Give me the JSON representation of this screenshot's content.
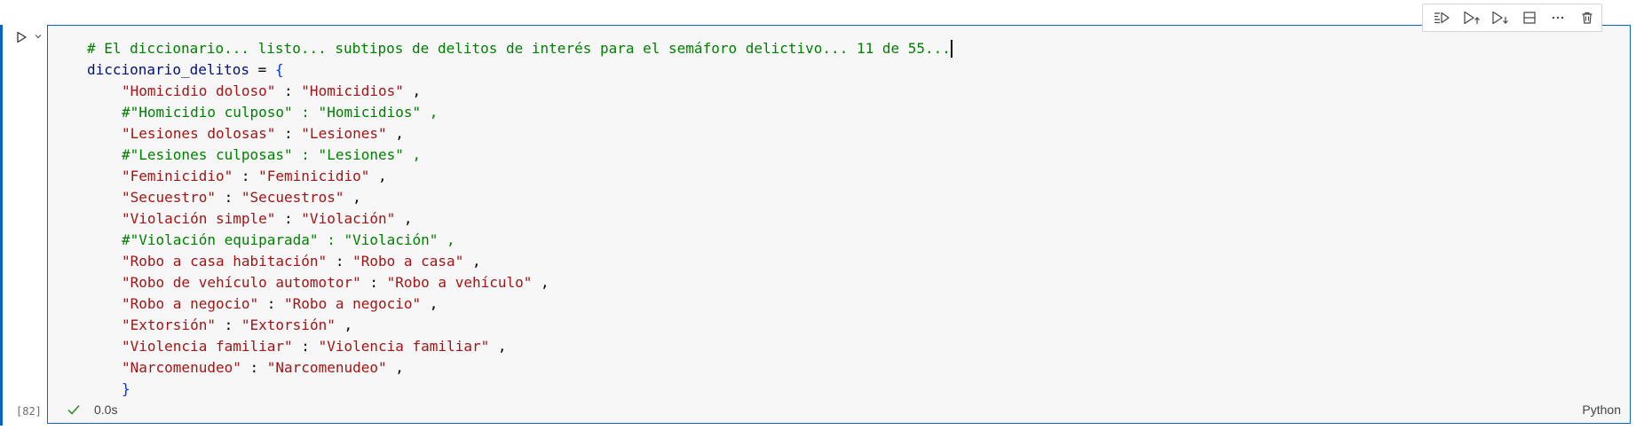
{
  "cell": {
    "execution_count": "[82]",
    "status": {
      "duration": "0.0s",
      "language": "Python",
      "success_color": "#388a34"
    },
    "code_lines": [
      {
        "kind": "comment",
        "text": "# El diccionario... listo... subtipos de delitos de interés para el semáforo delictivo... 11 de 55..."
      },
      {
        "kind": "assign",
        "var": "diccionario_delitos",
        "op": " = ",
        "brace": "{"
      },
      {
        "kind": "pair",
        "key": "\"Homicidio doloso\"",
        "sep": " : ",
        "val": "\"Homicidios\"",
        "end": " ,"
      },
      {
        "kind": "commented_pair",
        "text": "#\"Homicidio culposo\" : \"Homicidios\" ,"
      },
      {
        "kind": "pair",
        "key": "\"Lesiones dolosas\"",
        "sep": " : ",
        "val": "\"Lesiones\"",
        "end": " ,"
      },
      {
        "kind": "commented_pair",
        "text": "#\"Lesiones culposas\" : \"Lesiones\" ,"
      },
      {
        "kind": "pair",
        "key": "\"Feminicidio\"",
        "sep": " : ",
        "val": "\"Feminicidio\"",
        "end": " ,"
      },
      {
        "kind": "pair",
        "key": "\"Secuestro\"",
        "sep": " : ",
        "val": "\"Secuestros\"",
        "end": " ,"
      },
      {
        "kind": "pair",
        "key": "\"Violación simple\"",
        "sep": " : ",
        "val": "\"Violación\"",
        "end": " ,"
      },
      {
        "kind": "commented_pair",
        "text": "#\"Violación equiparada\" : \"Violación\" ,"
      },
      {
        "kind": "pair",
        "key": "\"Robo a casa habitación\"",
        "sep": " : ",
        "val": "\"Robo a casa\"",
        "end": " ,"
      },
      {
        "kind": "pair",
        "key": "\"Robo de vehículo automotor\"",
        "sep": " : ",
        "val": "\"Robo a vehículo\"",
        "end": " ,"
      },
      {
        "kind": "pair",
        "key": "\"Robo a negocio\"",
        "sep": " : ",
        "val": "\"Robo a negocio\"",
        "end": " ,"
      },
      {
        "kind": "pair",
        "key": "\"Extorsión\"",
        "sep": " : ",
        "val": "\"Extorsión\"",
        "end": " ,"
      },
      {
        "kind": "pair",
        "key": "\"Violencia familiar\"",
        "sep": " : ",
        "val": "\"Violencia familiar\"",
        "end": " ,"
      },
      {
        "kind": "pair",
        "key": "\"Narcomenudeo\"",
        "sep": " : ",
        "val": "\"Narcomenudeo\"",
        "end": " ,"
      },
      {
        "kind": "close",
        "brace": "}"
      }
    ]
  },
  "toolbar": {
    "icons": [
      "run-above-icon",
      "run-cell-and-above-icon",
      "run-cell-and-below-icon",
      "split-cell-icon",
      "more-actions-icon",
      "delete-cell-icon"
    ]
  },
  "colors": {
    "accent": "#0a64c8",
    "string": "#a31515",
    "comment": "#008000",
    "variable": "#001080",
    "brace": "#0431fa"
  }
}
